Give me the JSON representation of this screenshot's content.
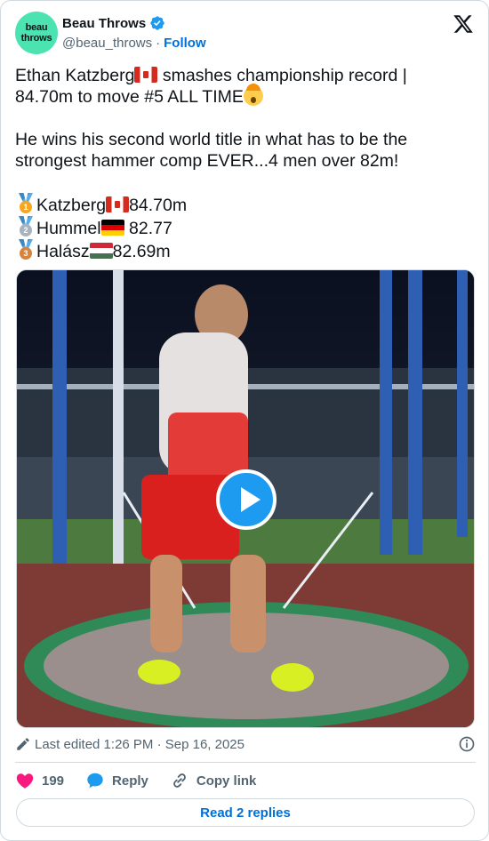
{
  "author": {
    "display_name": "Beau Throws",
    "handle": "@beau_throws",
    "separator": "·",
    "follow_label": "Follow",
    "avatar_line1": "beau",
    "avatar_line2": "throws",
    "avatar_color": "#4be3b0",
    "verified": true
  },
  "tweet": {
    "line1": "Ethan Katzberg",
    "line1b": " smashes championship record |",
    "line2": "84.70m to move #5 ALL TIME",
    "para2": "He wins his second world title in what has to be the strongest hammer comp EVER...4 men over 82m!",
    "results": [
      {
        "medal": "gold",
        "medal_number": "1",
        "name": "Katzberg",
        "flag": "ca",
        "mark": "84.70m"
      },
      {
        "medal": "silver",
        "medal_number": "2",
        "name": "Hummel",
        "flag": "de",
        "mark": " 82.77"
      },
      {
        "medal": "bronze",
        "medal_number": "3",
        "name": "Halász",
        "flag": "hu",
        "mark": "82.69m"
      }
    ]
  },
  "media": {
    "type": "video",
    "play_button_color": "#1d9bf0"
  },
  "meta": {
    "edited_label": "Last edited 1:26 PM · Sep 16, 2025"
  },
  "actions": {
    "like_count": "199",
    "reply_label": "Reply",
    "copy_link_label": "Copy link"
  },
  "read_replies_label": "Read 2 replies",
  "icons": [
    "verified-badge-icon",
    "x-logo-icon",
    "pencil-icon",
    "info-icon",
    "heart-icon",
    "reply-bubble-icon",
    "link-icon",
    "play-icon"
  ],
  "colors": {
    "accent": "#1d9bf0",
    "link": "#006fd6",
    "like": "#f91880",
    "muted": "#536471"
  }
}
